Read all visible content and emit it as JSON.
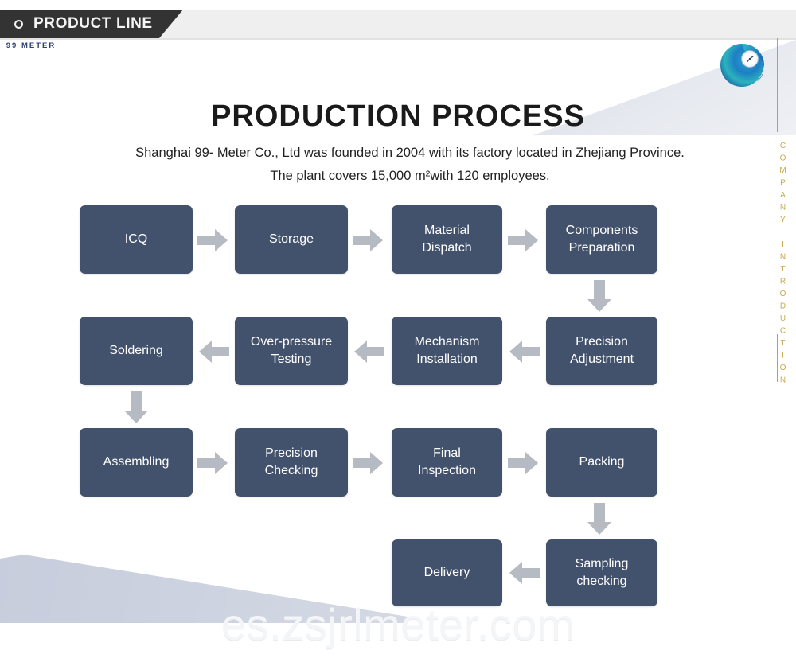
{
  "header": {
    "bullet_icon": "ring-icon",
    "title": "PRODUCT LINE"
  },
  "branding": {
    "logo_icon": "spiral-meter-logo-icon",
    "logo_text": "99 METER",
    "vertical_caption": "COMPANY INTRODUCTION",
    "gold_color": "#c9a84b"
  },
  "page": {
    "title": "PRODUCTION PROCESS",
    "subtitle": "Shanghai 99- Meter Co., Ltd was founded in 2004 with its factory located in Zhejiang Province. The plant covers 15,000 m²with 120 employees."
  },
  "theme": {
    "node_color": "#43526c",
    "arrow_color": "#b6bac2",
    "header_bar_color": "#333333",
    "wedge_color": "#ccd2df"
  },
  "flow": {
    "rows": [
      {
        "direction": "left-to-right",
        "nodes": [
          {
            "label": "ICQ"
          },
          {
            "label": "Storage"
          },
          {
            "label": "Material\nDispatch",
            "line1": "Material",
            "line2": "Dispatch"
          },
          {
            "label": "Components\nPreparation",
            "line1": "Components",
            "line2": "Preparation"
          }
        ]
      },
      {
        "direction": "right-to-left",
        "nodes": [
          {
            "label": "Soldering"
          },
          {
            "label": "Over-pressure\nTesting",
            "line1": "Over-pressure",
            "line2": "Testing"
          },
          {
            "label": "Mechanism\nInstallation",
            "line1": "Mechanism",
            "line2": "Installation"
          },
          {
            "label": "Precision\nAdjustment",
            "line1": "Precision",
            "line2": "Adjustment"
          }
        ]
      },
      {
        "direction": "left-to-right",
        "nodes": [
          {
            "label": "Assembling"
          },
          {
            "label": "Precision\nChecking",
            "line1": "Precision",
            "line2": "Checking"
          },
          {
            "label": "Final\nInspection",
            "line1": "Final",
            "line2": "Inspection"
          },
          {
            "label": "Packing"
          }
        ]
      },
      {
        "direction": "right-to-left",
        "nodes": [
          {
            "label": "Delivery"
          },
          {
            "label": "Sampling\nchecking",
            "line1": "Sampling",
            "line2": "checking"
          }
        ]
      }
    ],
    "connector_icons": {
      "right": "arrow-right-icon",
      "left": "arrow-left-icon",
      "down": "arrow-down-icon"
    }
  },
  "watermark": {
    "text": "es.zsjrlmeter.com"
  }
}
